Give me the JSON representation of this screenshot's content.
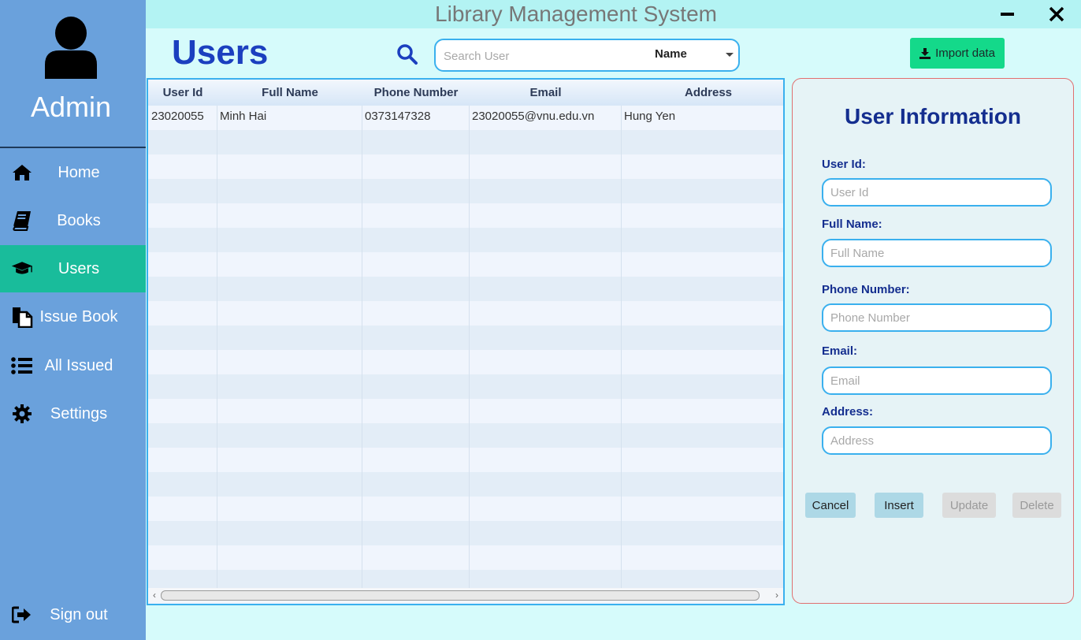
{
  "window": {
    "title": "Library Management System"
  },
  "sidebar": {
    "user_label": "Admin",
    "items": [
      {
        "label": "Home",
        "icon": "home-icon"
      },
      {
        "label": "Books",
        "icon": "book-icon"
      },
      {
        "label": "Users",
        "icon": "graduation-cap-icon",
        "active": true
      },
      {
        "label": "Issue Book",
        "icon": "copy-file-icon"
      },
      {
        "label": "All Issued",
        "icon": "list-icon"
      },
      {
        "label": "Settings",
        "icon": "gear-icon"
      }
    ],
    "signout_label": "Sign out"
  },
  "header": {
    "page_title": "Users",
    "search_placeholder": "Search User",
    "search_filter": "Name",
    "import_label": "Import data"
  },
  "table": {
    "columns": [
      "User Id",
      "Full Name",
      "Phone Number",
      "Email",
      "Address"
    ],
    "rows": [
      [
        "23020055",
        "Minh Hai",
        "0373147328",
        "23020055@vnu.edu.vn",
        "Hung Yen"
      ]
    ]
  },
  "form": {
    "title": "User Information",
    "fields": [
      {
        "label": "User Id:",
        "placeholder": "User Id",
        "value": ""
      },
      {
        "label": "Full Name:",
        "placeholder": "Full Name",
        "value": ""
      },
      {
        "label": "Phone Number:",
        "placeholder": "Phone Number",
        "value": ""
      },
      {
        "label": "Email:",
        "placeholder": "Email",
        "value": ""
      },
      {
        "label": "Address:",
        "placeholder": "Address",
        "value": ""
      }
    ],
    "buttons": {
      "cancel": "Cancel",
      "insert": "Insert",
      "update": "Update",
      "delete": "Delete"
    }
  },
  "colors": {
    "sidebar": "#6aa1dc",
    "active_item": "#19bc9b",
    "accent": "#3ab0ee",
    "title_blue": "#1b3fbf",
    "import_button": "#14d98a"
  }
}
